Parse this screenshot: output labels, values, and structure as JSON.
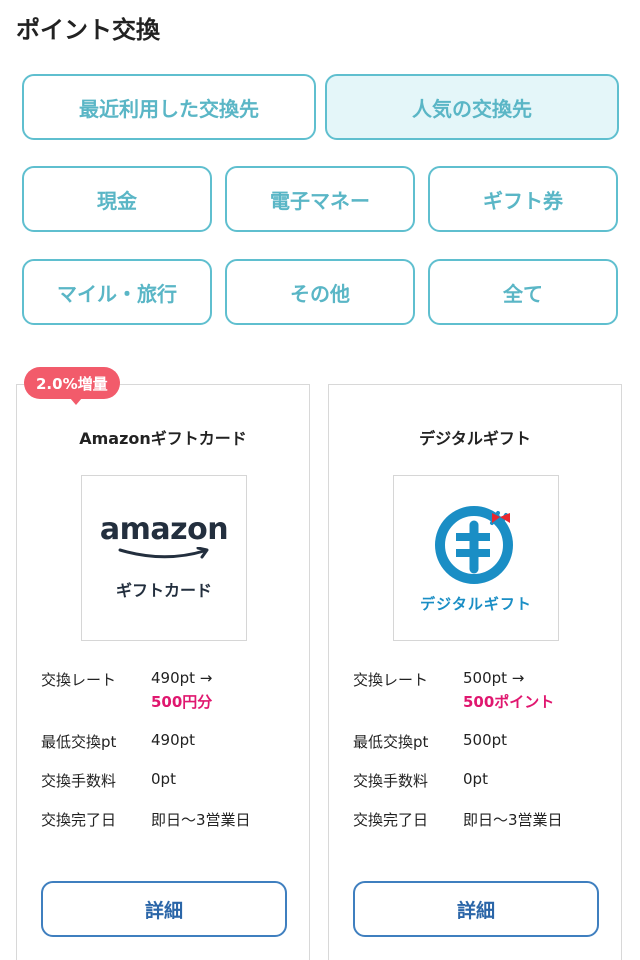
{
  "header": {
    "title": "ポイント交換"
  },
  "tabs": [
    {
      "label": "最近利用した交換先",
      "active": false
    },
    {
      "label": "人気の交換先",
      "active": true
    }
  ],
  "categories": [
    "現金",
    "電子マネー",
    "ギフト券",
    "マイル・旅行",
    "その他",
    "全て"
  ],
  "cards": [
    {
      "badge": "2.0%増量",
      "title": "Amazonギフトカード",
      "logo": {
        "icon": "amazon-logo",
        "wordmark": "amazon",
        "subtitle": "ギフトカード"
      },
      "rows": [
        {
          "label": "交換レート",
          "value": "490pt →",
          "highlight": "500円分"
        },
        {
          "label": "最低交換pt",
          "value": "490pt"
        },
        {
          "label": "交換手数料",
          "value": "0pt"
        },
        {
          "label": "交換完了日",
          "value": "即日〜3営業日"
        }
      ],
      "button": "詳細"
    },
    {
      "badge": "",
      "title": "デジタルギフト",
      "logo": {
        "icon": "digital-gift-logo",
        "subtitle": "デジタルギフト"
      },
      "rows": [
        {
          "label": "交換レート",
          "value": "500pt →",
          "highlight": "500ポイント"
        },
        {
          "label": "最低交換pt",
          "value": "500pt"
        },
        {
          "label": "交換手数料",
          "value": "0pt"
        },
        {
          "label": "交換完了日",
          "value": "即日〜3営業日"
        }
      ],
      "button": "詳細"
    }
  ],
  "colors": {
    "accent": "#5fbfcf",
    "highlight": "#e0176f",
    "badge": "#f25b6b",
    "button": "#3f7fbf"
  }
}
